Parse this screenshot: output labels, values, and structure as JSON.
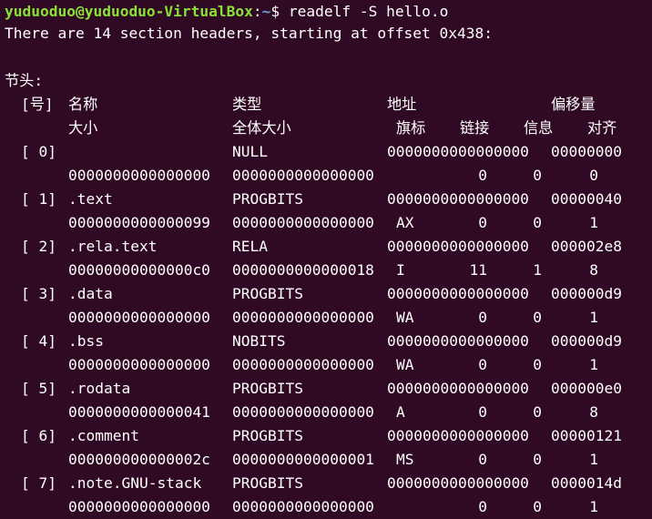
{
  "terminal": {
    "prompt": {
      "user_host": "yuduoduo@yuduoduo-VirtualBox",
      "sep": ":",
      "path": "~",
      "symbol": "$",
      "command": "readelf -S hello.o"
    },
    "summary": "There are 14 section headers, starting at offset 0x438:",
    "section_title": "节头:",
    "header1": {
      "num": "[号]",
      "name": "名称",
      "type": "类型",
      "address": "地址",
      "offset": "偏移量"
    },
    "header2": {
      "size": "大小",
      "entsize": "全体大小",
      "flags": "旗标",
      "link": "链接",
      "info": "信息",
      "align": "对齐"
    },
    "sections": [
      {
        "num": "[ 0]",
        "name": "",
        "type": "NULL",
        "address": "0000000000000000",
        "offset": "00000000",
        "size": "0000000000000000",
        "entsize": "0000000000000000",
        "flags": "",
        "link": "0",
        "info": "0",
        "align": "0"
      },
      {
        "num": "[ 1]",
        "name": ".text",
        "type": "PROGBITS",
        "address": "0000000000000000",
        "offset": "00000040",
        "size": "0000000000000099",
        "entsize": "0000000000000000",
        "flags": "AX",
        "link": "0",
        "info": "0",
        "align": "1"
      },
      {
        "num": "[ 2]",
        "name": ".rela.text",
        "type": "RELA",
        "address": "0000000000000000",
        "offset": "000002e8",
        "size": "00000000000000c0",
        "entsize": "0000000000000018",
        "flags": "I",
        "link": "11",
        "info": "1",
        "align": "8"
      },
      {
        "num": "[ 3]",
        "name": ".data",
        "type": "PROGBITS",
        "address": "0000000000000000",
        "offset": "000000d9",
        "size": "0000000000000000",
        "entsize": "0000000000000000",
        "flags": "WA",
        "link": "0",
        "info": "0",
        "align": "1"
      },
      {
        "num": "[ 4]",
        "name": ".bss",
        "type": "NOBITS",
        "address": "0000000000000000",
        "offset": "000000d9",
        "size": "0000000000000000",
        "entsize": "0000000000000000",
        "flags": "WA",
        "link": "0",
        "info": "0",
        "align": "1"
      },
      {
        "num": "[ 5]",
        "name": ".rodata",
        "type": "PROGBITS",
        "address": "0000000000000000",
        "offset": "000000e0",
        "size": "0000000000000041",
        "entsize": "0000000000000000",
        "flags": "A",
        "link": "0",
        "info": "0",
        "align": "8"
      },
      {
        "num": "[ 6]",
        "name": ".comment",
        "type": "PROGBITS",
        "address": "0000000000000000",
        "offset": "00000121",
        "size": "000000000000002c",
        "entsize": "0000000000000001",
        "flags": "MS",
        "link": "0",
        "info": "0",
        "align": "1"
      },
      {
        "num": "[ 7]",
        "name": ".note.GNU-stack",
        "type": "PROGBITS",
        "address": "0000000000000000",
        "offset": "0000014d",
        "size": "0000000000000000",
        "entsize": "0000000000000000",
        "flags": "",
        "link": "0",
        "info": "0",
        "align": "1"
      }
    ]
  }
}
